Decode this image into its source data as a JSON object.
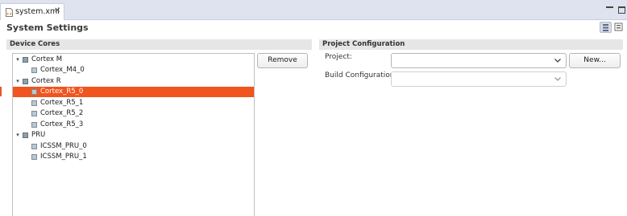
{
  "tab": {
    "label": "system.xml",
    "close": "✕"
  },
  "page": {
    "title": "System Settings"
  },
  "device_cores": {
    "header": "Device Cores",
    "groups": [
      {
        "label": "Cortex M",
        "children": [
          "Cortex_M4_0"
        ]
      },
      {
        "label": "Cortex R",
        "children": [
          "Cortex_R5_0",
          "Cortex_R5_1",
          "Cortex_R5_2",
          "Cortex_R5_3"
        ]
      },
      {
        "label": "PRU",
        "children": [
          "ICSSM_PRU_0",
          "ICSSM_PRU_1"
        ]
      }
    ],
    "selected": "Cortex_R5_0",
    "remove_label": "Remove"
  },
  "project_config": {
    "header": "Project Configuration",
    "project_label": "Project:",
    "project_value": "",
    "new_label": "New...",
    "build_label": "Build Configuration:",
    "build_value": ""
  },
  "colors": {
    "selection": "#f0541f",
    "tab_strip": "#dfe2ef",
    "section_header": "#e6e6e6"
  },
  "icons": [
    "xml-file-icon",
    "close-icon",
    "minimize-icon",
    "maximize-icon",
    "tree-layout-icon",
    "form-layout-icon",
    "chevron-down-icon",
    "core-group-icon",
    "core-icon"
  ]
}
